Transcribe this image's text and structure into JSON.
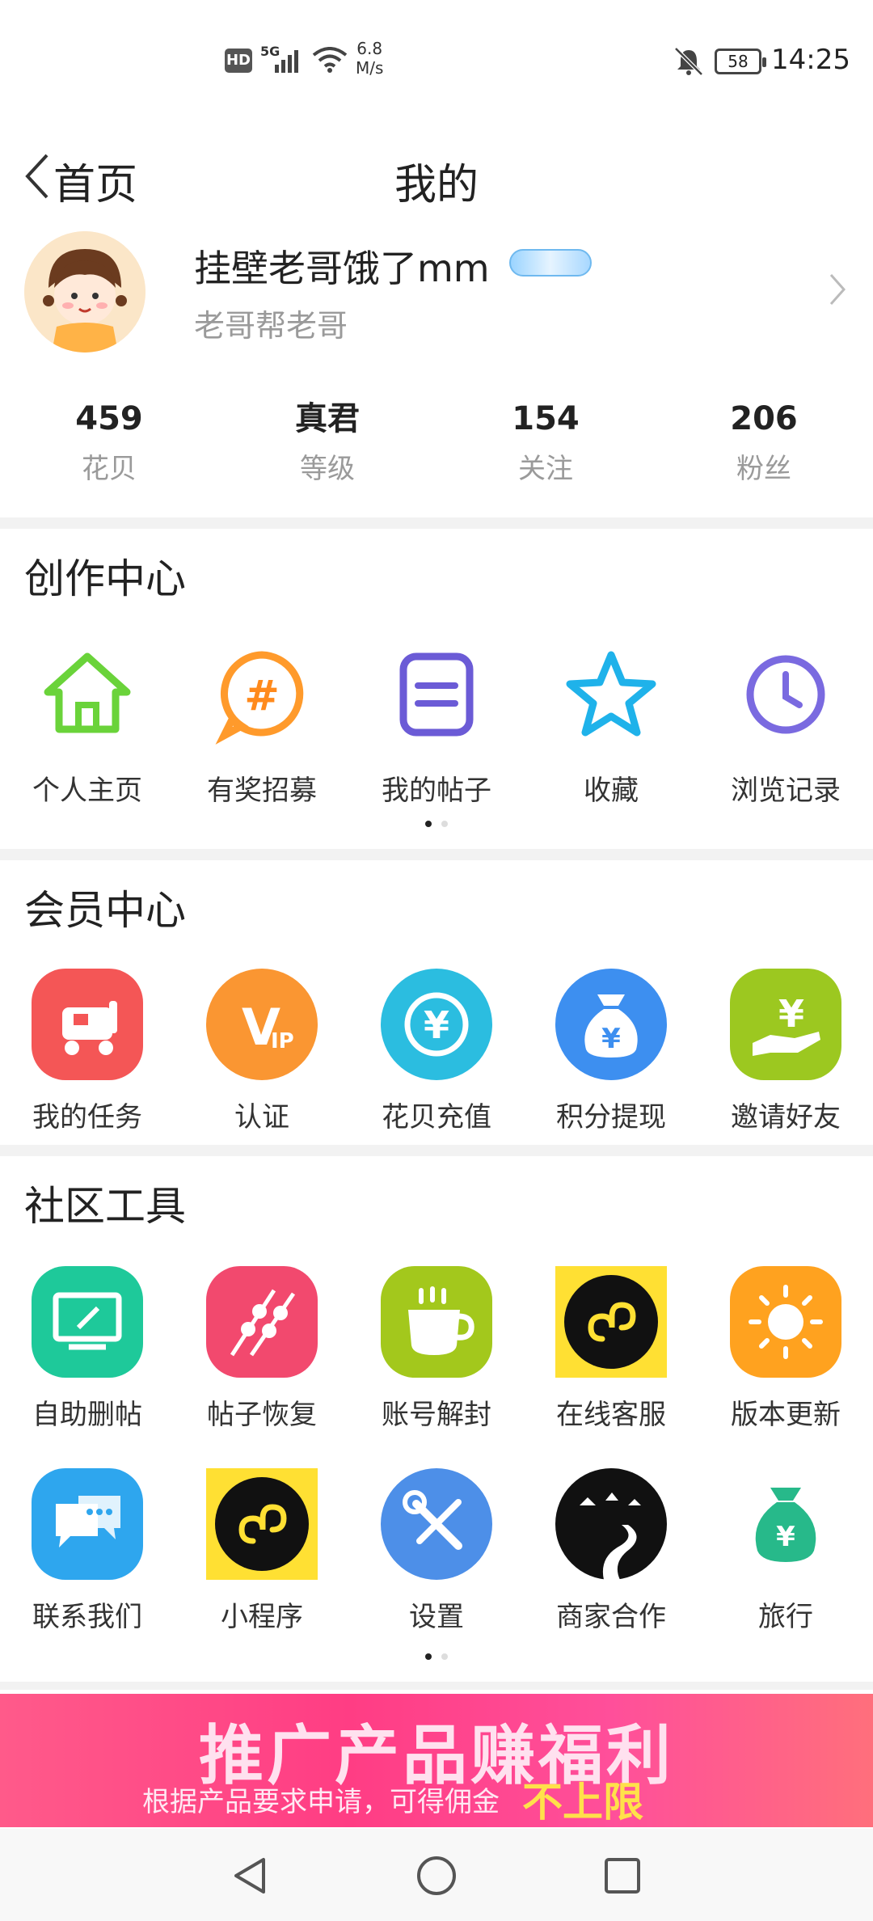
{
  "status_bar": {
    "hd": "HD",
    "network": "5G",
    "speed_value": "6.8",
    "speed_unit": "M/s",
    "battery": "58",
    "time": "14:25"
  },
  "header": {
    "back_label": "首页",
    "title": "我的"
  },
  "profile": {
    "username": "挂壁老哥饿了mm",
    "signature": "老哥帮老哥"
  },
  "stats": [
    {
      "value": "459",
      "label": "花贝"
    },
    {
      "value": "真君",
      "label": "等级"
    },
    {
      "value": "154",
      "label": "关注"
    },
    {
      "value": "206",
      "label": "粉丝"
    }
  ],
  "creation_center": {
    "title": "创作中心",
    "items": [
      {
        "label": "个人主页",
        "icon": "home-icon"
      },
      {
        "label": "有奖招募",
        "icon": "hashtag-icon"
      },
      {
        "label": "我的帖子",
        "icon": "document-icon"
      },
      {
        "label": "收藏",
        "icon": "star-icon"
      },
      {
        "label": "浏览记录",
        "icon": "clock-icon"
      }
    ]
  },
  "member_center": {
    "title": "会员中心",
    "items": [
      {
        "label": "我的任务",
        "icon": "task-icon",
        "color": "#f45656"
      },
      {
        "label": "认证",
        "icon": "vip-icon",
        "color": "#fa9632"
      },
      {
        "label": "花贝充值",
        "icon": "recharge-icon",
        "color": "#2bbde0"
      },
      {
        "label": "积分提现",
        "icon": "money-bag-icon",
        "color": "#3d8ff0"
      },
      {
        "label": "邀请好友",
        "icon": "invite-icon",
        "color": "#9cc820"
      }
    ]
  },
  "community_tools": {
    "title": "社区工具",
    "items": [
      {
        "label": "自助删帖",
        "icon": "monitor-icon",
        "color": "#1ec99a"
      },
      {
        "label": "帖子恢复",
        "icon": "skewer-icon",
        "color": "#f2496e"
      },
      {
        "label": "账号解封",
        "icon": "coffee-icon",
        "color": "#a3c81c"
      },
      {
        "label": "在线客服",
        "icon": "mini-program-icon",
        "color": "#ffe033"
      },
      {
        "label": "版本更新",
        "icon": "sun-icon",
        "color": "#ffa21f"
      },
      {
        "label": "联系我们",
        "icon": "chat-icon",
        "color": "#2ea6ee"
      },
      {
        "label": "小程序",
        "icon": "mini-program-icon",
        "color": "#ffe033"
      },
      {
        "label": "设置",
        "icon": "wrench-icon",
        "color": "#4d8fe8"
      },
      {
        "label": "商家合作",
        "icon": "road-icon",
        "color": "#111111"
      },
      {
        "label": "旅行",
        "icon": "money-bag-icon",
        "color": "#27b98a"
      }
    ]
  },
  "banner": {
    "title": "推广产品赚福利",
    "subtitle": "根据产品要求申请，可得佣金",
    "highlight": "不上限"
  }
}
